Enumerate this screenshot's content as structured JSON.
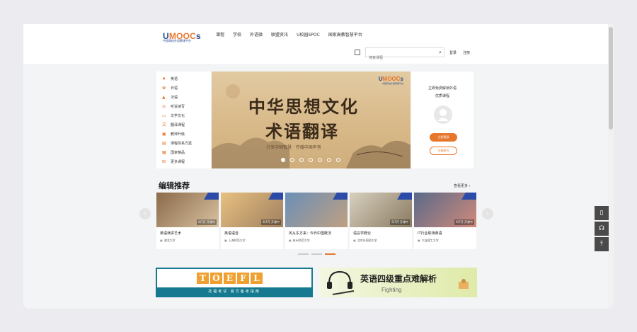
{
  "header": {
    "logo": "UMOOCs",
    "logo_sub": "中国高校外语慕课平台",
    "nav": [
      "课程",
      "学校",
      "外语微",
      "联盟资讯",
      "U校园SPOC",
      "国家高教智慧平台"
    ],
    "search_placeholder": "搜索课程",
    "login": "登录",
    "register": "注册"
  },
  "categories": [
    {
      "label": "英语",
      "icon": "microphone-icon"
    },
    {
      "label": "日语",
      "icon": "sakura-icon"
    },
    {
      "label": "法语",
      "icon": "tower-icon"
    },
    {
      "label": "听说读写",
      "icon": "headphone-icon"
    },
    {
      "label": "文学文化",
      "icon": "book-icon"
    },
    {
      "label": "翻译课程",
      "icon": "translate-icon"
    },
    {
      "label": "教师升级",
      "icon": "teacher-icon"
    },
    {
      "label": "课程体系方案",
      "icon": "doc-icon"
    },
    {
      "label": "国家精品",
      "icon": "award-icon"
    },
    {
      "label": "更多课程",
      "icon": "grid-icon"
    }
  ],
  "banner": {
    "title_line1": "中华思想文化",
    "title_line2": "术语翻译",
    "subtitle": "分享中国智慧 · 传播中国声音",
    "logo": "UMOOCs",
    "logo_sub": "中国高校外语慕课平台",
    "slide_count": 7,
    "active_slide": 0
  },
  "login_panel": {
    "line1": "立即免费解锁外语",
    "line2": "优质课程",
    "login_button": "立即登录",
    "register_button": "注册账号"
  },
  "recommend": {
    "title": "编辑推荐",
    "see_more": "查看更多 ›",
    "cards": [
      {
        "title": "英语演讲艺术",
        "school": "湖北大学",
        "status": "6/7开 开课中",
        "color1": "#8a6a4a",
        "color2": "#d9c2a0"
      },
      {
        "title": "英语语音",
        "school": "上海师范大学",
        "status": "6/7开 开课中",
        "color1": "#e8c080",
        "color2": "#a08060"
      },
      {
        "title": "风从东方来：今日中国概况",
        "school": "杭州师范大学",
        "status": "",
        "color1": "#6a8fb8",
        "color2": "#c0a080"
      },
      {
        "title": "语言学概论",
        "school": "北京外国语大学",
        "status": "5/7开 开课中",
        "color1": "#d8d0c0",
        "color2": "#8a7a60"
      },
      {
        "title": "IT行业职场英语",
        "school": "大连理工大学",
        "status": "6/7开 开课中",
        "color1": "#5a6a8a",
        "color2": "#d08a7a"
      }
    ],
    "pager_count": 3,
    "pager_active": 2
  },
  "ads": {
    "toefl_letters": [
      "T",
      "O",
      "E",
      "F",
      "L"
    ],
    "toefl_caption": "托福考试 官方备考指南",
    "cet4_title": "英语四级重点难解析",
    "cet4_sub": "Fighting"
  },
  "side_tools": [
    "phone-icon",
    "headset-icon",
    "back-to-top-icon"
  ],
  "colors": {
    "accent": "#e8772e",
    "brand_blue": "#2b4a8f",
    "toefl_teal": "#157a8f"
  }
}
